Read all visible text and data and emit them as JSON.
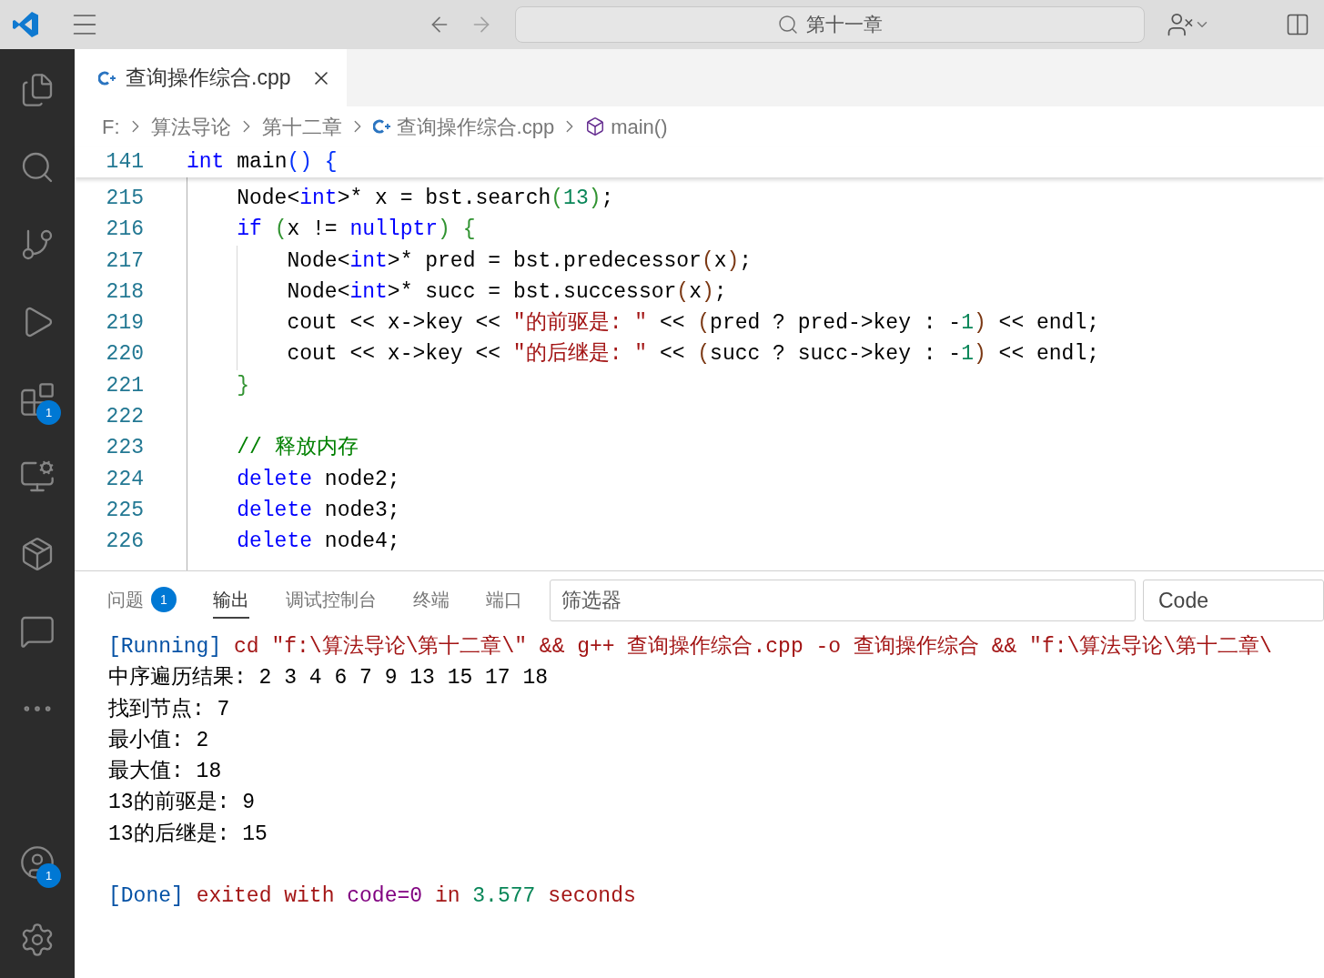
{
  "title_bar": {
    "search": "第十一章"
  },
  "activity_bar": [
    {
      "kind": "files"
    },
    {
      "kind": "search"
    },
    {
      "kind": "source-control"
    },
    {
      "kind": "run-debug"
    },
    {
      "kind": "extensions",
      "badge": "1"
    },
    {
      "kind": "remote"
    },
    {
      "kind": "package"
    },
    {
      "kind": "chat"
    },
    {
      "kind": "more"
    }
  ],
  "activity_bottom": [
    {
      "kind": "account",
      "badge": "1"
    },
    {
      "kind": "settings"
    }
  ],
  "tabs": [
    {
      "label": "查询操作综合.cpp",
      "selected": true
    }
  ],
  "breadcrumbs": [
    {
      "kind": "text",
      "label": "F:"
    },
    {
      "kind": "text",
      "label": "算法导论"
    },
    {
      "kind": "text",
      "label": "第十二章"
    },
    {
      "kind": "file",
      "label": "查询操作综合.cpp"
    },
    {
      "kind": "symbol",
      "label": "main()"
    }
  ],
  "sticky_line": {
    "number": "141",
    "tokens": [
      {
        "text": "int",
        "kind": "kw"
      },
      {
        "text": " main",
        "kind": "plain"
      },
      {
        "text": "() ",
        "kind": "b1"
      },
      {
        "text": "{",
        "kind": "b1"
      }
    ]
  },
  "code_lines": [
    {
      "number": "215",
      "tokens": [
        {
          "text": "    Node<",
          "kind": "plain"
        },
        {
          "text": "int",
          "kind": "kw"
        },
        {
          "text": ">* x = bst.search",
          "kind": "plain"
        },
        {
          "text": "(",
          "kind": "b2"
        },
        {
          "text": "13",
          "kind": "num"
        },
        {
          "text": ")",
          "kind": "b2"
        },
        {
          "text": ";",
          "kind": "plain"
        }
      ]
    },
    {
      "number": "216",
      "tokens": [
        {
          "text": "    if",
          "kind": "kw"
        },
        {
          "text": " (",
          "kind": "b2"
        },
        {
          "text": "x != ",
          "kind": "plain"
        },
        {
          "text": "nullptr",
          "kind": "kw"
        },
        {
          "text": ") {",
          "kind": "b2"
        }
      ]
    },
    {
      "number": "217",
      "tokens": [
        {
          "text": "        Node<",
          "kind": "plain"
        },
        {
          "text": "int",
          "kind": "kw"
        },
        {
          "text": ">* pred = bst.predecessor",
          "kind": "plain"
        },
        {
          "text": "(",
          "kind": "b3"
        },
        {
          "text": "x",
          "kind": "plain"
        },
        {
          "text": ")",
          "kind": "b3"
        },
        {
          "text": ";",
          "kind": "plain"
        }
      ]
    },
    {
      "number": "218",
      "tokens": [
        {
          "text": "        Node<",
          "kind": "plain"
        },
        {
          "text": "int",
          "kind": "kw"
        },
        {
          "text": ">* succ = bst.successor",
          "kind": "plain"
        },
        {
          "text": "(",
          "kind": "b3"
        },
        {
          "text": "x",
          "kind": "plain"
        },
        {
          "text": ")",
          "kind": "b3"
        },
        {
          "text": ";",
          "kind": "plain"
        }
      ]
    },
    {
      "number": "219",
      "tokens": [
        {
          "text": "        cout << x->key << ",
          "kind": "plain"
        },
        {
          "text": "\"的前驱是: \"",
          "kind": "str"
        },
        {
          "text": " << ",
          "kind": "plain"
        },
        {
          "text": "(",
          "kind": "b3"
        },
        {
          "text": "pred ? pred->key : -",
          "kind": "plain"
        },
        {
          "text": "1",
          "kind": "num"
        },
        {
          "text": ")",
          "kind": "b3"
        },
        {
          "text": " << endl;",
          "kind": "plain"
        }
      ]
    },
    {
      "number": "220",
      "tokens": [
        {
          "text": "        cout << x->key << ",
          "kind": "plain"
        },
        {
          "text": "\"的后继是: \"",
          "kind": "str"
        },
        {
          "text": " << ",
          "kind": "plain"
        },
        {
          "text": "(",
          "kind": "b3"
        },
        {
          "text": "succ ? succ->key : -",
          "kind": "plain"
        },
        {
          "text": "1",
          "kind": "num"
        },
        {
          "text": ")",
          "kind": "b3"
        },
        {
          "text": " << endl;",
          "kind": "plain"
        }
      ]
    },
    {
      "number": "221",
      "tokens": [
        {
          "text": "    }",
          "kind": "b2"
        }
      ]
    },
    {
      "number": "222"
    },
    {
      "number": "223",
      "tokens": [
        {
          "text": "    // 释放内存",
          "kind": "comment"
        }
      ]
    },
    {
      "number": "224",
      "tokens": [
        {
          "text": "    delete",
          "kind": "kw"
        },
        {
          "text": " node2;",
          "kind": "plain"
        }
      ]
    },
    {
      "number": "225",
      "tokens": [
        {
          "text": "    delete",
          "kind": "kw"
        },
        {
          "text": " node3;",
          "kind": "plain"
        }
      ]
    },
    {
      "number": "226",
      "tokens": [
        {
          "text": "    delete",
          "kind": "kw"
        },
        {
          "text": " node4;",
          "kind": "plain"
        }
      ]
    }
  ],
  "panel_tabs": [
    {
      "label": "问题",
      "badge": "1",
      "selected": false
    },
    {
      "label": "输出",
      "selected": true
    },
    {
      "label": "调试控制台",
      "selected": false
    },
    {
      "label": "终端",
      "selected": false
    },
    {
      "label": "端口",
      "selected": false
    }
  ],
  "filter": {
    "placeholder": "筛选器"
  },
  "channel": "Code",
  "output_lines": [
    {
      "tokens": [
        {
          "text": "[Running]",
          "kind": "tag"
        },
        {
          "text": " cd \"f:\\算法导论\\第十二章\\\" && g++ 查询操作综合.cpp -o 查询操作综合 && \"f:\\算法导论\\第十二章\\",
          "kind": "err"
        }
      ]
    },
    {
      "tokens": [
        {
          "text": "中序遍历结果: 2 3 4 6 7 9 13 15 17 18",
          "kind": "plain"
        }
      ]
    },
    {
      "tokens": [
        {
          "text": "找到节点: 7",
          "kind": "plain"
        }
      ]
    },
    {
      "tokens": [
        {
          "text": "最小值: 2",
          "kind": "plain"
        }
      ]
    },
    {
      "tokens": [
        {
          "text": "最大值: 18",
          "kind": "plain"
        }
      ]
    },
    {
      "tokens": [
        {
          "text": "13的前驱是: 9",
          "kind": "plain"
        }
      ]
    },
    {
      "tokens": [
        {
          "text": "13的后继是: 15",
          "kind": "plain"
        }
      ]
    },
    {
      "gap_before": true,
      "tokens": [
        {
          "text": "[Done]",
          "kind": "tag"
        },
        {
          "text": " exited with ",
          "kind": "err"
        },
        {
          "text": "code=0",
          "kind": "purple"
        },
        {
          "text": " in ",
          "kind": "err"
        },
        {
          "text": "3.577",
          "kind": "num"
        },
        {
          "text": " seconds",
          "kind": "err"
        }
      ]
    }
  ]
}
